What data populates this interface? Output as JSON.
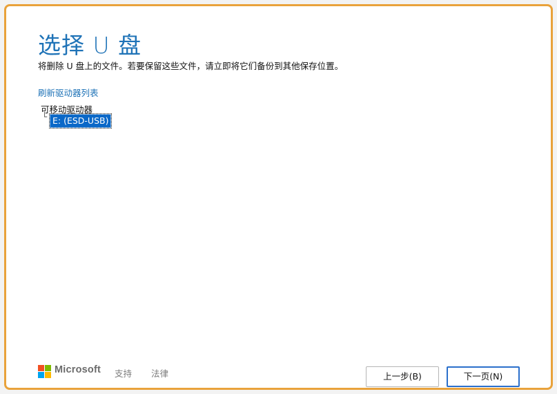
{
  "page": {
    "title": "选择 U 盘",
    "subtitle": "将删除 U 盘上的文件。若要保留这些文件，请立即将它们备份到其他保存位置。"
  },
  "drives": {
    "refresh_link": "刷新驱动器列表",
    "category": "可移动驱动器",
    "tree_connector": "└",
    "items": [
      {
        "label": "E: (ESD-USB)",
        "selected": true
      }
    ]
  },
  "footer": {
    "brand": "Microsoft",
    "logo_colors": [
      "#f25022",
      "#7fba00",
      "#00a4ef",
      "#ffb900"
    ],
    "links": [
      "支持",
      "法律"
    ]
  },
  "buttons": {
    "back": "上一步(B)",
    "next": "下一页(N)"
  },
  "colors": {
    "accent": "#1f73b7",
    "frame_border": "#e9a23b",
    "selection": "#0a68c8"
  }
}
